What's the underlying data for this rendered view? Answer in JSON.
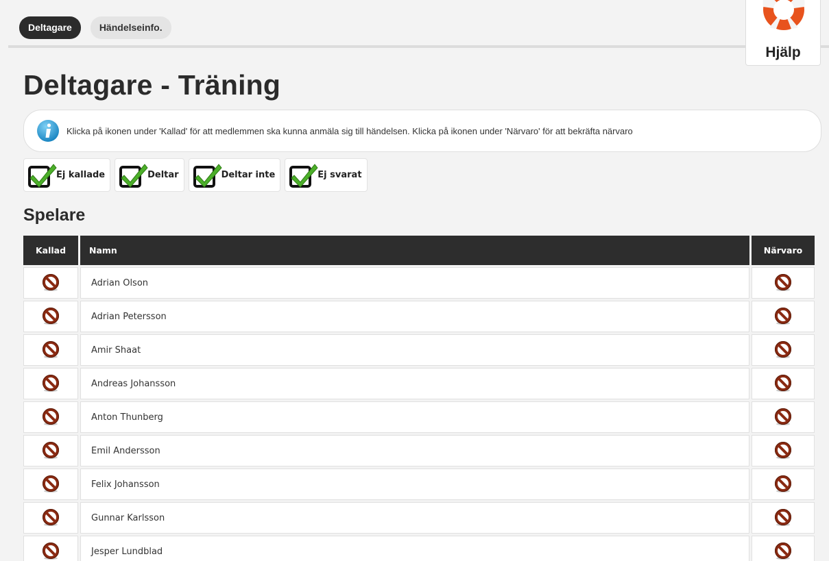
{
  "tabs": [
    {
      "label": "Deltagare",
      "active": true
    },
    {
      "label": "Händelseinfo.",
      "active": false
    }
  ],
  "help": {
    "label": "Hjälp",
    "icon": "lifebuoy-icon"
  },
  "page_title": "Deltagare - Träning",
  "info": {
    "icon": "info-icon",
    "text": "Klicka på ikonen under 'Kallad' för att medlemmen ska kunna anmäla sig till händelsen. Klicka på ikonen under 'Närvaro' för att bekräfta närvaro"
  },
  "filters": [
    {
      "label": "Ej kallade",
      "icon": "checkbox-check-icon"
    },
    {
      "label": "Deltar",
      "icon": "checkbox-check-icon"
    },
    {
      "label": "Deltar inte",
      "icon": "checkbox-check-icon"
    },
    {
      "label": "Ej svarat",
      "icon": "checkbox-check-icon"
    }
  ],
  "section_title": "Spelare",
  "table": {
    "headers": {
      "kallad": "Kallad",
      "namn": "Namn",
      "narvaro": "Närvaro"
    },
    "row_icon": "no-entry-icon",
    "rows": [
      {
        "name": "Adrian Olson"
      },
      {
        "name": "Adrian Petersson"
      },
      {
        "name": "Amir Shaat"
      },
      {
        "name": "Andreas Johansson"
      },
      {
        "name": "Anton Thunberg"
      },
      {
        "name": "Emil Andersson"
      },
      {
        "name": "Felix Johansson"
      },
      {
        "name": "Gunnar Karlsson"
      },
      {
        "name": "Jesper Lundblad"
      }
    ]
  },
  "colors": {
    "accent_dark": "#2b2b2b",
    "icon_red": "#b03a1e",
    "check_green": "#4caf2a",
    "info_blue": "#2a9fd6",
    "lifebuoy_orange": "#e8531d"
  }
}
